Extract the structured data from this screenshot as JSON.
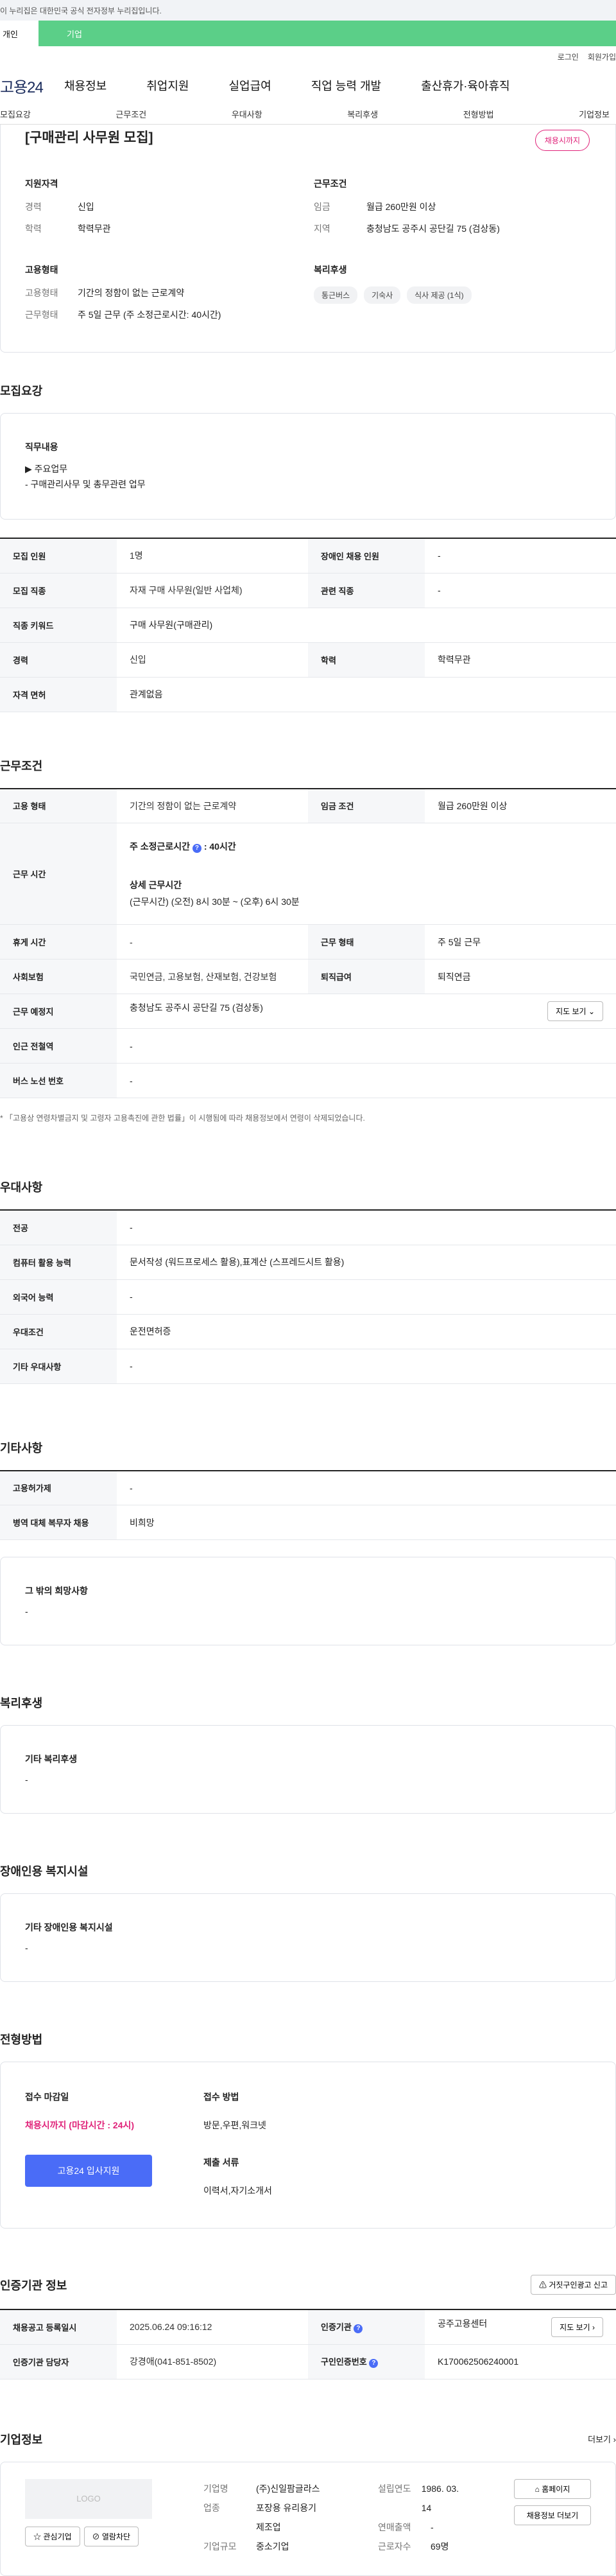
{
  "notice": "이 누리집은 대한민국 공식 전자정부 누리집입니다.",
  "tabs": [
    "개인",
    "기업"
  ],
  "util": [
    "로그인",
    "회원가입"
  ],
  "gnb": {
    "logo": "고용24",
    "menu": [
      "채용정보",
      "취업지원",
      "실업급여",
      "직업 능력 개발",
      "출산휴가·육아휴직"
    ]
  },
  "subnav": [
    "모집요강",
    "근무조건",
    "우대사항",
    "복리후생",
    "전형방법",
    "기업정보"
  ],
  "summary": {
    "title": "[구매관리 사무원 모집]",
    "status": "채용시까지",
    "qual_title": "지원자격",
    "qual": [
      {
        "k": "경력",
        "v": "신입"
      },
      {
        "k": "학력",
        "v": "학력무관"
      }
    ],
    "cond_title": "근무조건",
    "cond": [
      {
        "k": "임금",
        "v": "월급 260만원 이상"
      },
      {
        "k": "지역",
        "v": "충청남도 공주시 공단길 75 (검상동)"
      }
    ],
    "emp_title": "고용형태",
    "emp": [
      {
        "k": "고용형태",
        "v": "기간의 정함이 없는 근로계약"
      },
      {
        "k": "근무형태",
        "v": "주 5일 근무 (주 소정근로시간: 40시간)"
      }
    ],
    "welfare_title": "복리후생",
    "chips": [
      "통근버스",
      "기숙사",
      "식사 제공 (1식)"
    ]
  },
  "recruit": {
    "title": "모집요강",
    "duty_title": "직무내용",
    "duty_lines": [
      "▶ 주요업무",
      " - 구매관리사무 및 총무관련 업무"
    ],
    "rows": [
      [
        "모집 인원",
        "1명",
        "장애인 채용 인원",
        "-"
      ],
      [
        "모집 직종",
        "자재 구매 사무원(일반 사업체)",
        "관련 직종",
        "-"
      ],
      [
        "직종 키워드",
        "구매 사무원(구매관리)",
        "",
        ""
      ],
      [
        "경력",
        "신입",
        "학력",
        "학력무관"
      ],
      [
        "자격 면허",
        "관계없음",
        "",
        ""
      ]
    ]
  },
  "work": {
    "title": "근무조건",
    "r1": [
      "고용 형태",
      "기간의 정함이 없는 근로계약",
      "임금 조건",
      "월급 260만원 이상"
    ],
    "time_label": "근무 시간",
    "time_week": "주 소정근로시간",
    "time_week_val": ": 40시간",
    "time_detail_title": "상세 근무시간",
    "time_detail": "(근무시간) (오전) 8시 30분 ~ (오후) 6시 30분",
    "r2": [
      "휴게 시간",
      "-",
      "근무 형태",
      "주 5일 근무"
    ],
    "r3": [
      "사회보험",
      "국민연금, 고용보험, 산재보험, 건강보험",
      "퇴직급여",
      "퇴직연금"
    ],
    "loc_label": "근무 예정지",
    "loc": "충청남도 공주시 공단길 75 (검상동)",
    "map_btn": "지도 보기",
    "r4": [
      "인근 전철역",
      "-"
    ],
    "r5": [
      "버스 노선 번호",
      "-"
    ],
    "note": "* 「고용상 연령차별금지 및 고령자 고용촉진에 관한 법률」이 시행됨에 따라 채용정보에서 연령이 삭제되었습니다."
  },
  "pref": {
    "title": "우대사항",
    "rows": [
      [
        "전공",
        "-"
      ],
      [
        "컴퓨터 활용 능력",
        "문서작성 (워드프로세스 활용),표계산 (스프레드시트 활용)"
      ],
      [
        "외국어 능력",
        "-"
      ],
      [
        "우대조건",
        "운전면허증"
      ],
      [
        "기타 우대사항",
        "-"
      ]
    ]
  },
  "etc": {
    "title": "기타사항",
    "rows": [
      [
        "고용허가제",
        "-"
      ],
      [
        "병역 대체 복무자 채용",
        "비희망"
      ]
    ],
    "box_title": "그 밖의 희망사항",
    "box_val": "-"
  },
  "welfare": {
    "title": "복리후생",
    "box_title": "기타 복리후생",
    "box_val": "-"
  },
  "disabled": {
    "title": "장애인용 복지시설",
    "box_title": "기타 장애인용 복지시설",
    "box_val": "-"
  },
  "process": {
    "title": "전형방법",
    "deadline_label": "접수 마감일",
    "deadline_val": "채용시까지 (마감시간 : 24시)",
    "apply_btn": "고용24 입사지원",
    "method_label": "접수 방법",
    "method_val": "방문,우편,워크넷",
    "docs_label": "제출 서류",
    "docs_val": "이력서,자기소개서"
  },
  "cert": {
    "title": "인증기관 정보",
    "report_btn": "거짓구인광고 신고",
    "rows": [
      [
        "채용공고 등록일시",
        "2025.06.24 09:16:12",
        "인증기관",
        "공주고용센터"
      ],
      [
        "인증기관 담당자",
        "강경애(041-851-8502)",
        "구인인증번호",
        "K170062506240001"
      ]
    ],
    "map_btn": "지도 보기"
  },
  "company": {
    "title": "기업정보",
    "more": "더보기",
    "logo": "LOGO",
    "interest_btn": "관심기업",
    "block_btn": "열람차단",
    "name_k": "기업명",
    "name_v": "(주)신일팜글라스",
    "biz_k": "업종",
    "biz_v": "포장용 유리용기 제조업",
    "size_k": "기업규모",
    "size_v": "중소기업",
    "year_k": "설립연도",
    "year_v": "1986. 03. 14",
    "sales_k": "연매출액",
    "sales_v": "-",
    "staff_k": "근로자수",
    "staff_v": "69명",
    "home_btn": "홈페이지",
    "jobs_btn": "채용정보 더보기"
  }
}
